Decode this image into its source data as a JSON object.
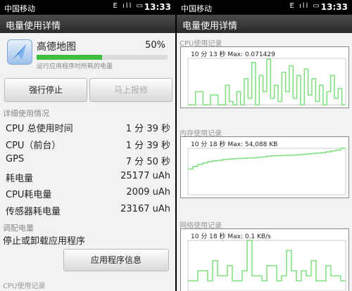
{
  "status": {
    "carrier": "中国移动",
    "time": "13:33",
    "icons": "E ıll ▭"
  },
  "left": {
    "title": "电量使用详情",
    "app": {
      "name": "高德地图",
      "percent": "50%",
      "percent_value": 0.5,
      "description": "运行应用程序时所耗的电量"
    },
    "buttons": {
      "stop": "强行停止",
      "report": "马上报修"
    },
    "detail_section": "详细使用情况",
    "rows": [
      {
        "label": "CPU 总使用时间",
        "value": "1 分 39 秒"
      },
      {
        "label": "CPU（前台）",
        "value": "1 分 39 秒"
      },
      {
        "label": "GPS",
        "value": "7 分 50 秒"
      },
      {
        "label": "耗电量",
        "value": "25177 uAh"
      },
      {
        "label": "CPU耗电量",
        "value": "2009 uAh"
      },
      {
        "label": "传感器耗电量",
        "value": "23167 uAh"
      }
    ],
    "adjust_section": "调配电量",
    "adjust_text": "停止或卸载应用程序",
    "info_button": "应用程序信息",
    "footer_label": "CPU使用记录"
  },
  "right": {
    "title": "电量使用详情",
    "charts": [
      {
        "label": "CPU使用记录",
        "stat": "10 分 13 秒 Max: 0.071429",
        "color": "#7ee07e"
      },
      {
        "label": "内存使用记录",
        "stat": "10 分 18 秒 Max: 54,088 KB",
        "color": "#7ee07e"
      },
      {
        "label": "网络使用记录",
        "stat": "10 分 18 秒 Max: 0.1 KB/s",
        "color": "#7ee07e"
      }
    ]
  },
  "chart_data": [
    {
      "type": "line",
      "title": "CPU使用记录",
      "stat": "10 分 13 秒 Max: 0.071429",
      "values": [
        0,
        0,
        0.02,
        0.02,
        0,
        0,
        0.015,
        0.015,
        0,
        0,
        0.03,
        0.005,
        0,
        0.02,
        0,
        0.04,
        0.01,
        0.065,
        0,
        0.045,
        0.02,
        0.07,
        0.01,
        0.03,
        0.005,
        0.05,
        0.02,
        0.06,
        0.01,
        0.045,
        0,
        0.055,
        0.015,
        0.04,
        0.005,
        0.03,
        0,
        0.02,
        0.045,
        0.01,
        0.025,
        0
      ],
      "ylim": [
        0,
        0.071429
      ]
    },
    {
      "type": "line",
      "title": "内存使用记录",
      "stat": "10 分 18 秒 Max: 54,088 KB",
      "values": [
        30000,
        33000,
        35500,
        37000,
        38500,
        39500,
        40000,
        41000,
        41500,
        42000,
        42300,
        42500,
        42800,
        43000,
        43500,
        44000,
        45000,
        45200,
        45500,
        45800,
        46000,
        46200,
        46500,
        47000,
        47500,
        48000,
        48500,
        49000,
        50000,
        51000,
        52000,
        54088
      ],
      "ylim": [
        0,
        54088
      ]
    },
    {
      "type": "line",
      "title": "网络使用记录",
      "stat": "10 分 18 秒 Max: 0.1 KB/s",
      "values": [
        0.02,
        0.02,
        0.04,
        0.04,
        0.02,
        0.06,
        0.03,
        0.03,
        0.05,
        0.02,
        0.02,
        0.04,
        0.1,
        0.03,
        0.03,
        0.02,
        0.05,
        0.05,
        0.02,
        0.03,
        0.08,
        0.04,
        0.02,
        0.04,
        0.03,
        0.06,
        0.02,
        0.02,
        0.05,
        0.03,
        0.03,
        0.02
      ],
      "ylim": [
        0,
        0.1
      ]
    }
  ]
}
